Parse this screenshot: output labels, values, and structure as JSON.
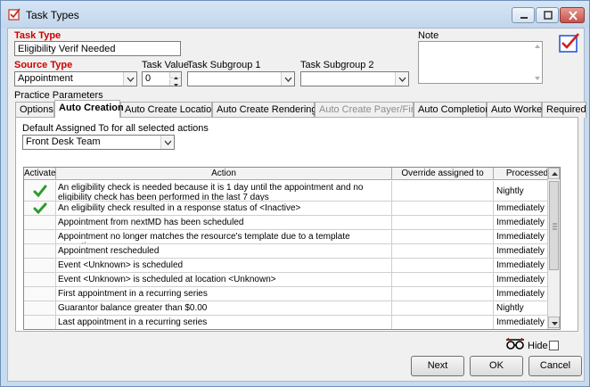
{
  "window": {
    "title": "Task Types"
  },
  "form": {
    "task_type_label": "Task Type",
    "task_type_value": "Eligibility Verif Needed",
    "source_type_label": "Source Type",
    "source_type_value": "Appointment",
    "task_value_label": "Task Value",
    "task_value_value": "0",
    "subgroup1_label": "Task Subgroup 1",
    "subgroup1_value": "",
    "subgroup2_label": "Task Subgroup 2",
    "subgroup2_value": "",
    "note_label": "Note",
    "note_value": "",
    "practice_params_label": "Practice Parameters"
  },
  "tabs": [
    {
      "label": "Options"
    },
    {
      "label": "Auto Creation",
      "active": true
    },
    {
      "label": "Auto Create Location"
    },
    {
      "label": "Auto Create Rendering"
    },
    {
      "label": "Auto Create Payer/Fin...",
      "disabled": true
    },
    {
      "label": "Auto Completion"
    },
    {
      "label": "Auto Worker"
    },
    {
      "label": "Required"
    }
  ],
  "auto_creation": {
    "default_assigned_label": "Default Assigned To for all selected actions",
    "default_assigned_value": "Front Desk Team"
  },
  "grid": {
    "columns": [
      "Activate",
      "Action",
      "Override assigned to",
      "Processed"
    ],
    "rows": [
      {
        "activate": true,
        "action": "An eligibility check is needed because it is 1 day until the appointment and no eligibility check has been performed in the last 7 days",
        "override": "",
        "processed": "Nightly"
      },
      {
        "activate": true,
        "action": "An eligibility check resulted in a response status of <Inactive>",
        "override": "",
        "processed": "Immediately"
      },
      {
        "activate": false,
        "action": "Appointment from nextMD has been scheduled",
        "override": "",
        "processed": "Immediately"
      },
      {
        "activate": false,
        "action": "Appointment no longer matches the resource's template due to a template exception",
        "override": "",
        "processed": "Immediately"
      },
      {
        "activate": false,
        "action": "Appointment rescheduled",
        "override": "",
        "processed": "Immediately"
      },
      {
        "activate": false,
        "action": "Event <Unknown> is scheduled",
        "override": "",
        "processed": "Immediately"
      },
      {
        "activate": false,
        "action": "Event <Unknown> is scheduled at location <Unknown>",
        "override": "",
        "processed": "Immediately"
      },
      {
        "activate": false,
        "action": "First appointment in a recurring series",
        "override": "",
        "processed": "Immediately"
      },
      {
        "activate": false,
        "action": "Guarantor balance greater than $0.00",
        "override": "",
        "processed": "Nightly"
      },
      {
        "activate": false,
        "action": "Last appointment in a recurring series",
        "override": "",
        "processed": "Immediately"
      }
    ]
  },
  "footer": {
    "hide_label": "Hide",
    "next_label": "Next",
    "ok_label": "OK",
    "cancel_label": "Cancel"
  },
  "colors": {
    "required_label": "#cc0000",
    "check": "#2e9a2e",
    "title_bar": "#c8daee"
  }
}
